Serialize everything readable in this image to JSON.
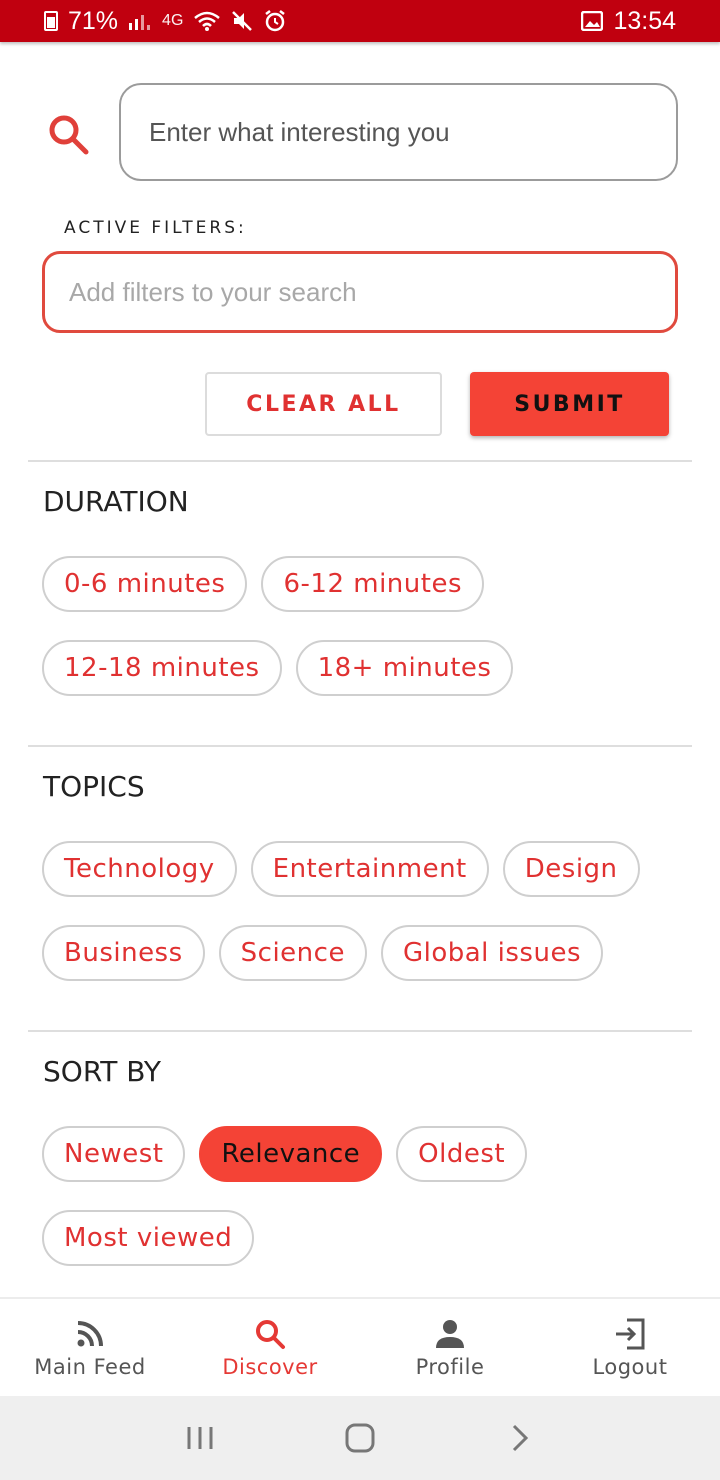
{
  "status_bar": {
    "battery": "71%",
    "network": "4G",
    "time": "13:54"
  },
  "search": {
    "placeholder": "Enter what interesting you"
  },
  "filters": {
    "label": "ACTIVE FILTERS:",
    "placeholder": "Add filters to your search"
  },
  "actions": {
    "clear_label": "CLEAR ALL",
    "submit_label": "SUBMIT"
  },
  "duration": {
    "title": "DURATION",
    "chips": [
      "0-6 minutes",
      "6-12 minutes",
      "12-18 minutes",
      "18+ minutes"
    ]
  },
  "topics": {
    "title": "TOPICS",
    "chips": [
      "Technology",
      "Entertainment",
      "Design",
      "Business",
      "Science",
      "Global issues"
    ]
  },
  "sort": {
    "title": "SORT BY",
    "chips": [
      "Newest",
      "Relevance",
      "Oldest",
      "Most viewed"
    ],
    "selected": "Relevance"
  },
  "nav": {
    "items": [
      {
        "label": "Main Feed",
        "icon": "rss-icon"
      },
      {
        "label": "Discover",
        "icon": "search-icon"
      },
      {
        "label": "Profile",
        "icon": "person-icon"
      },
      {
        "label": "Logout",
        "icon": "logout-icon"
      }
    ],
    "active": "Discover"
  },
  "colors": {
    "status_bar": "#c0000f",
    "accent": "#f44336",
    "chip_text": "#e03131"
  }
}
